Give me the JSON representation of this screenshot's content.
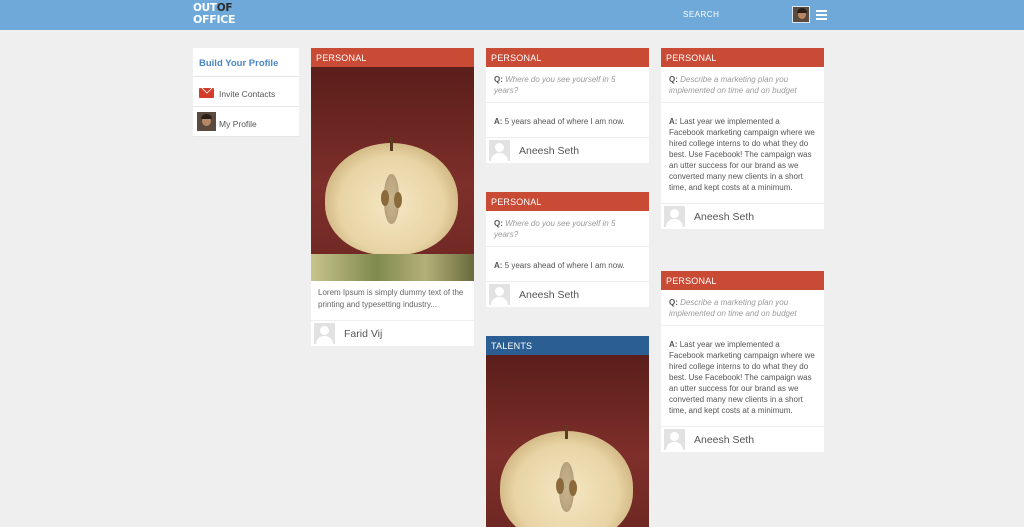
{
  "header": {
    "logo_line1_a": "OUT",
    "logo_line1_b": "OF",
    "logo_line2": "OFFICE",
    "search_label": "SEARCH",
    "accent_color": "#6ea9d9"
  },
  "sidebar": {
    "title": "Build Your Profile",
    "items": [
      {
        "label": "Invite Contacts",
        "icon": "mail-icon"
      },
      {
        "label": "My Profile",
        "icon": "avatar"
      }
    ]
  },
  "cards": {
    "c1": {
      "category": "PERSONAL",
      "description": "Lorem Ipsum is simply dummy text of the printing and typesetting industry...",
      "author": "Farid Vij"
    },
    "c2": {
      "category": "PERSONAL",
      "q_label": "Q:",
      "question": "Where do you see yourself in 5 years?",
      "a_label": "A:",
      "answer": "5 years ahead of where I am now.",
      "author": "Aneesh Seth"
    },
    "c3": {
      "category": "PERSONAL",
      "q_label": "Q:",
      "question": "Where do you see yourself in 5 years?",
      "a_label": "A:",
      "answer": "5 years ahead of where I am now.",
      "author": "Aneesh Seth"
    },
    "c4": {
      "category": "TALENTS"
    },
    "c5": {
      "category": "PERSONAL",
      "q_label": "Q:",
      "question": "Describe a marketing plan you implemented on time and on budget",
      "a_label": "A:",
      "answer": "Last year we implemented a Facebook marketing campaign where we hired college interns to do what they do best. Use Facebook! The campaign was an utter success for our brand as we converted many new clients in a short time, and kept costs at a minimum.",
      "author": "Aneesh Seth"
    },
    "c6": {
      "category": "PERSONAL",
      "q_label": "Q:",
      "question": "Describe a marketing plan you implemented on time and on budget",
      "a_label": "A:",
      "answer": "Last year we implemented a Facebook marketing campaign where we hired college interns to do what they do best. Use Facebook! The campaign was an utter success for our brand as we converted many new clients in a short time, and kept costs at a minimum.",
      "author": "Aneesh Seth"
    }
  },
  "colors": {
    "personal": "#c94a35",
    "talents": "#2b5f93"
  }
}
